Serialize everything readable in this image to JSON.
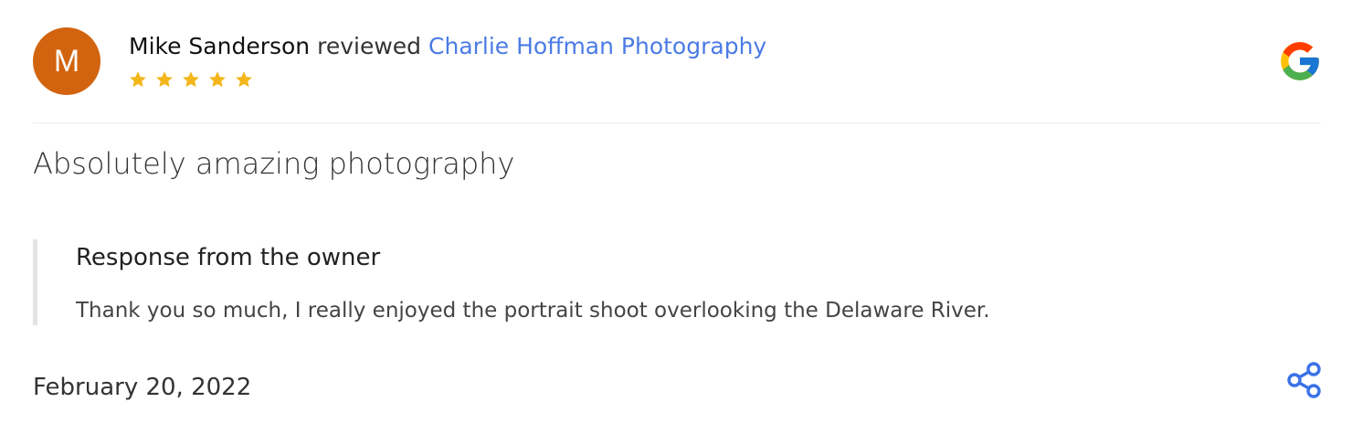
{
  "review": {
    "avatar_initial": "M",
    "reviewer_name": "Mike Sanderson",
    "verb": "reviewed",
    "business_name": "Charlie Hoffman Photography",
    "rating": 5,
    "rating_max": 5,
    "title": "Absolutely amazing photography",
    "date": "February 20, 2022"
  },
  "owner_response": {
    "heading": "Response from the owner",
    "text": "Thank you so much, I really enjoyed the portrait shoot overlooking the Delaware River."
  },
  "icons": {
    "source": "google-g-icon",
    "share": "share-icon",
    "star": "star-icon"
  },
  "colors": {
    "avatar_bg": "#d2640f",
    "link": "#4b7be5",
    "star": "#f3b61b",
    "share": "#3a72e8",
    "google_blue": "#4285F4",
    "google_red": "#EA4335",
    "google_yellow": "#FBBC05",
    "google_green": "#34A853"
  }
}
